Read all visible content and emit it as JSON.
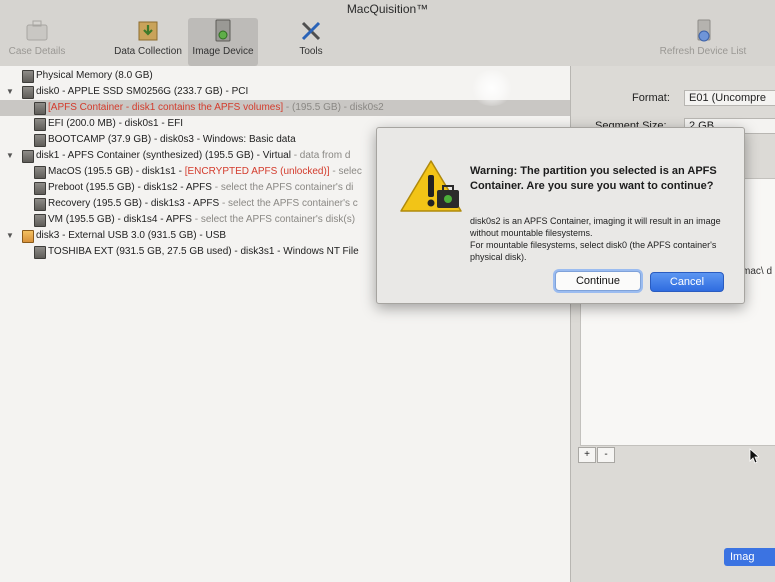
{
  "window": {
    "title": "MacQuisition™"
  },
  "toolbar": {
    "case_details": "Case Details",
    "data_collection": "Data Collection",
    "image_device": "Image Device",
    "tools": "Tools",
    "refresh": "Refresh Device List"
  },
  "tree": {
    "rows": [
      {
        "text": "Physical Memory (8.0 GB)"
      },
      {
        "text": "disk0 - APPLE SSD SM0256G (233.7 GB) - PCI"
      },
      {
        "text": "[APFS Container - disk1 contains the APFS volumes]",
        "extra": " - (195.5 GB) - disk0s2"
      },
      {
        "text": "EFI (200.0 MB) - disk0s1 - EFI"
      },
      {
        "text": "BOOTCAMP (37.9 GB) - disk0s3 - Windows: Basic data"
      },
      {
        "text": "disk1 - APFS Container (synthesized) (195.5 GB) - Virtual",
        "extra": " - data from d"
      },
      {
        "text": "MacOS (195.5 GB) - disk1s1 - ",
        "red": "[ENCRYPTED APFS (unlocked)]",
        "extra": " - selec"
      },
      {
        "text": "Preboot (195.5 GB) - disk1s2 - APFS",
        "extra": " - select the APFS container's di"
      },
      {
        "text": "Recovery (195.5 GB) - disk1s3 - APFS",
        "extra": " - select the APFS container's c"
      },
      {
        "text": "VM (195.5 GB) - disk1s4 - APFS",
        "extra": " - select the APFS container's disk(s)"
      },
      {
        "text": "disk3 - External USB 3.0 (931.5 GB) - USB"
      },
      {
        "text": "TOSHIBA EXT (931.5 GB, 27.5 GB used) - disk3s1 - Windows NT File"
      }
    ]
  },
  "settings": {
    "format_label": "Format:",
    "format_value": "E01 (Uncompre",
    "segment_label": "Segment Size:",
    "segment_value": "2 GB",
    "fragment_text": "mac\\ d",
    "add_label": "+",
    "remove_label": "-",
    "image_button": "Imag"
  },
  "dialog": {
    "title": "Warning:  The partition you selected is an APFS Container. Are you sure you want to continue?",
    "body_line1": "disk0s2 is an APFS Container, imaging it will result in an image without mountable filesystems.",
    "body_line2": "For mountable filesystems, select disk0 (the APFS container's physical disk).",
    "continue_label": "Continue",
    "cancel_label": "Cancel"
  },
  "colors": {
    "accent": "#3b73e2",
    "warning_red": "#d33b2c",
    "warning_yellow": "#f2c417"
  }
}
